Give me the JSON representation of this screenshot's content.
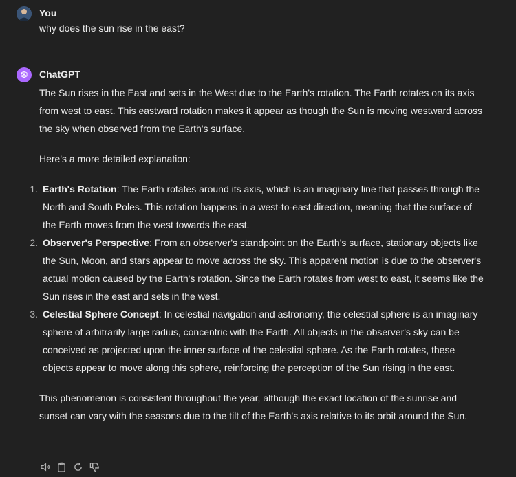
{
  "user_message": {
    "author": "You",
    "text": "why does the sun rise in the east?"
  },
  "assistant_message": {
    "author": "ChatGPT",
    "intro": "The Sun rises in the East and sets in the West due to the Earth's rotation. The Earth rotates on its axis from west to east. This eastward rotation makes it appear as though the Sun is moving westward across the sky when observed from the Earth's surface.",
    "detail_heading": "Here's a more detailed explanation:",
    "items": [
      {
        "number": "1.",
        "title": "Earth's Rotation",
        "text": ": The Earth rotates around its axis, which is an imaginary line that passes through the North and South Poles. This rotation happens in a west-to-east direction, meaning that the surface of the Earth moves from the west towards the east."
      },
      {
        "number": "2.",
        "title": "Observer's Perspective",
        "text": ": From an observer's standpoint on the Earth's surface, stationary objects like the Sun, Moon, and stars appear to move across the sky. This apparent motion is due to the observer's actual motion caused by the Earth's rotation. Since the Earth rotates from west to east, it seems like the Sun rises in the east and sets in the west."
      },
      {
        "number": "3.",
        "title": "Celestial Sphere Concept",
        "text": ": In celestial navigation and astronomy, the celestial sphere is an imaginary sphere of arbitrarily large radius, concentric with the Earth. All objects in the observer's sky can be conceived as projected upon the inner surface of the celestial sphere. As the Earth rotates, these objects appear to move along this sphere, reinforcing the perception of the Sun rising in the east."
      }
    ],
    "outro": "This phenomenon is consistent throughout the year, although the exact location of the sunrise and sunset can vary with the seasons due to the tilt of the Earth's axis relative to its orbit around the Sun."
  },
  "actions": [
    "speaker-icon",
    "clipboard-icon",
    "regenerate-icon",
    "thumbs-down-icon"
  ],
  "colors": {
    "background": "#212121",
    "text": "#ececec",
    "muted": "#b4b4b4",
    "gpt_avatar": "#ab68ff"
  }
}
